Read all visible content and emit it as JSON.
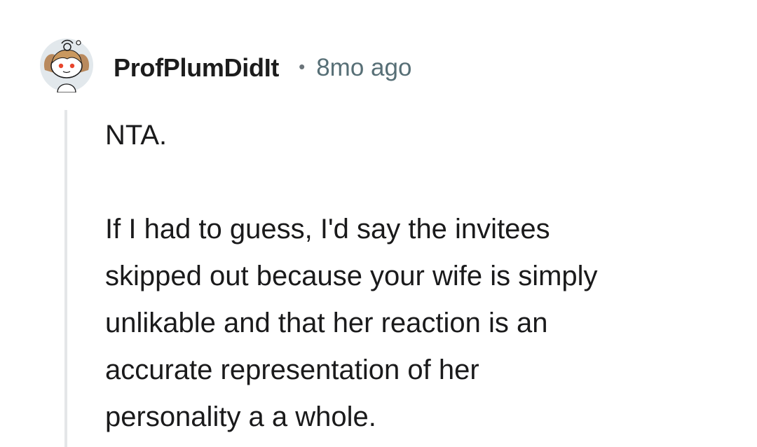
{
  "comment": {
    "username": "ProfPlumDidIt",
    "separator": "•",
    "timestamp": "8mo ago",
    "avatar_icon": "snoo-avatar-icon",
    "body": {
      "paragraph_1": "NTA.",
      "paragraph_2_lines": [
        "If I had to guess, I'd say the invitees",
        "skipped out because your wife is simply",
        "unlikable and that her reaction is an",
        "accurate representation of her",
        "personality a a whole."
      ]
    }
  },
  "colors": {
    "username": "#1c1c1c",
    "timestamp": "#576f76",
    "body_text": "#1a1a1b",
    "thread_line": "#e4e6e8",
    "avatar_hair": "#b98a5e",
    "avatar_background": "#e2e8ec"
  }
}
